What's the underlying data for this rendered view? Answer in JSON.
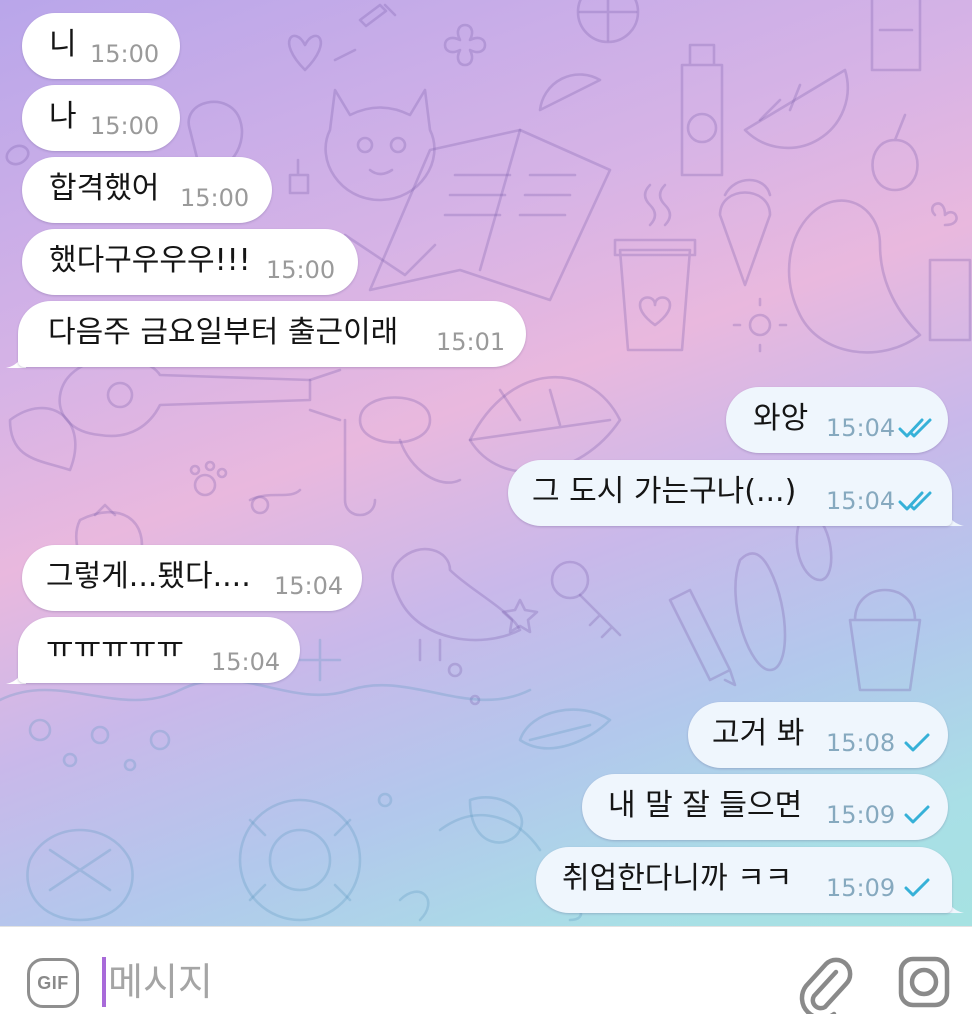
{
  "messages": [
    {
      "direction": "in",
      "text": "니",
      "time": "15:00"
    },
    {
      "direction": "in",
      "text": "나",
      "time": "15:00"
    },
    {
      "direction": "in",
      "text": "합격했어",
      "time": "15:00"
    },
    {
      "direction": "in",
      "text": "했다구우우우!!!",
      "time": "15:00"
    },
    {
      "direction": "in",
      "text": "다음주 금요일부터 출근이래",
      "time": "15:01"
    },
    {
      "direction": "out",
      "text": "와앙",
      "time": "15:04",
      "status": "read"
    },
    {
      "direction": "out",
      "text": "그 도시 가는구나(...)",
      "time": "15:04",
      "status": "read"
    },
    {
      "direction": "in",
      "text": "그렇게...됐다....",
      "time": "15:04"
    },
    {
      "direction": "in",
      "text": "ㅠㅠㅠㅠㅠ",
      "time": "15:04"
    },
    {
      "direction": "out",
      "text": "고거 봐",
      "time": "15:08",
      "status": "sent"
    },
    {
      "direction": "out",
      "text": "내 말 잘 들으면",
      "time": "15:09",
      "status": "sent"
    },
    {
      "direction": "out",
      "text": "취업한다니까 ㅋㅋ",
      "time": "15:09",
      "status": "sent"
    }
  ],
  "composer": {
    "gif_label": "GIF",
    "placeholder": "메시지",
    "value": "",
    "attach_icon": "paperclip-icon",
    "camera_icon": "camera-icon"
  },
  "colors": {
    "incoming_bubble": "#ffffff",
    "outgoing_bubble": "#eff6fd",
    "check_color": "#36b1d8",
    "caret": "#a86ad9"
  }
}
